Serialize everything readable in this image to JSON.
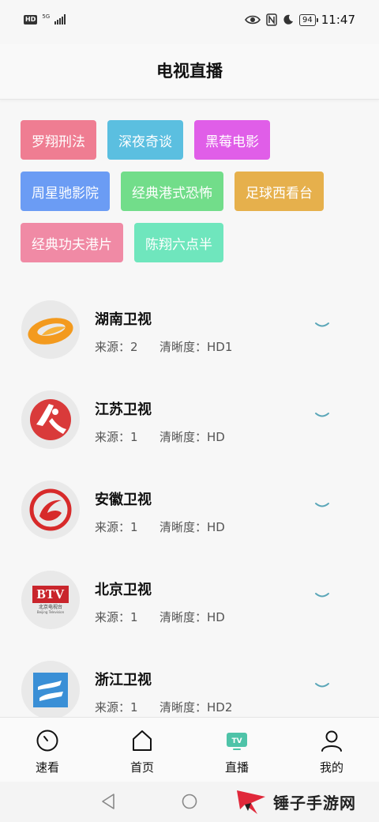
{
  "status_bar": {
    "hd": "HD",
    "network": "5G",
    "battery": "94",
    "time": "11:47"
  },
  "header": {
    "title": "电视直播"
  },
  "tags": [
    {
      "label": "罗翔刑法",
      "color": "#ef7d92"
    },
    {
      "label": "深夜奇谈",
      "color": "#5bbfe0"
    },
    {
      "label": "黑莓电影",
      "color": "#e05ee8"
    },
    {
      "label": "周星驰影院",
      "color": "#6b9cf4"
    },
    {
      "label": "经典港式恐怖",
      "color": "#72dd8a"
    },
    {
      "label": "足球西看台",
      "color": "#e6b04c"
    },
    {
      "label": "经典功夫港片",
      "color": "#f08aa5"
    },
    {
      "label": "陈翔六点半",
      "color": "#6fe6bd"
    }
  ],
  "channels": [
    {
      "name": "湖南卫视",
      "source": "来源：2",
      "clarity": "清晰度：HD1",
      "logo": "hunan-tv-logo"
    },
    {
      "name": "江苏卫视",
      "source": "来源：1",
      "clarity": "清晰度：HD",
      "logo": "jiangsu-tv-logo"
    },
    {
      "name": "安徽卫视",
      "source": "来源：1",
      "clarity": "清晰度：HD",
      "logo": "anhui-tv-logo"
    },
    {
      "name": "北京卫视",
      "source": "来源：1",
      "clarity": "清晰度：HD",
      "logo": "btv-logo",
      "logo_text": "BTV",
      "logo_sub": "北京电视台",
      "logo_sub2": "Beijing Television"
    },
    {
      "name": "浙江卫视",
      "source": "来源：1",
      "clarity": "清晰度：HD2",
      "logo": "zhejiang-tv-logo"
    }
  ],
  "bottom_nav": [
    {
      "label": "速看",
      "icon": "clock-icon",
      "active": false
    },
    {
      "label": "首页",
      "icon": "home-icon",
      "active": false
    },
    {
      "label": "直播",
      "icon": "tv-icon",
      "active": true
    },
    {
      "label": "我的",
      "icon": "user-icon",
      "active": false
    }
  ],
  "watermark": {
    "text": "锤子手游网"
  },
  "colors": {
    "accent": "#4ec3a8",
    "chevron": "#5aa6b8"
  }
}
